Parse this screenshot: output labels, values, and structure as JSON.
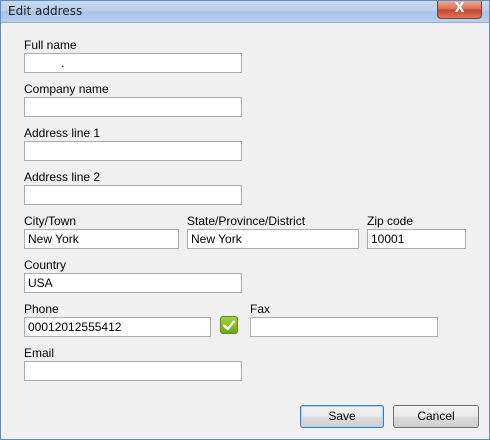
{
  "window": {
    "title": "Edit address",
    "close_label": "X"
  },
  "form": {
    "full_name": {
      "label": "Full name",
      "value": "."
    },
    "company_name": {
      "label": "Company name",
      "value": ""
    },
    "address_line_1": {
      "label": "Address line 1",
      "value": ""
    },
    "address_line_2": {
      "label": "Address line 2",
      "value": ""
    },
    "city": {
      "label": "City/Town",
      "value": "New York"
    },
    "state": {
      "label": "State/Province/District",
      "value": "New York"
    },
    "zip": {
      "label": "Zip code",
      "value": "10001"
    },
    "country": {
      "label": "Country",
      "value": "USA"
    },
    "phone": {
      "label": "Phone",
      "value": "00012012555412"
    },
    "fax": {
      "label": "Fax",
      "value": ""
    },
    "email": {
      "label": "Email",
      "value": ""
    }
  },
  "buttons": {
    "save": "Save",
    "cancel": "Cancel"
  },
  "colors": {
    "titlebar": "#b9d1ef",
    "close": "#c7432b",
    "check": "#7ab526"
  },
  "icons": {
    "phone_valid": "check-icon",
    "close": "close-icon"
  }
}
